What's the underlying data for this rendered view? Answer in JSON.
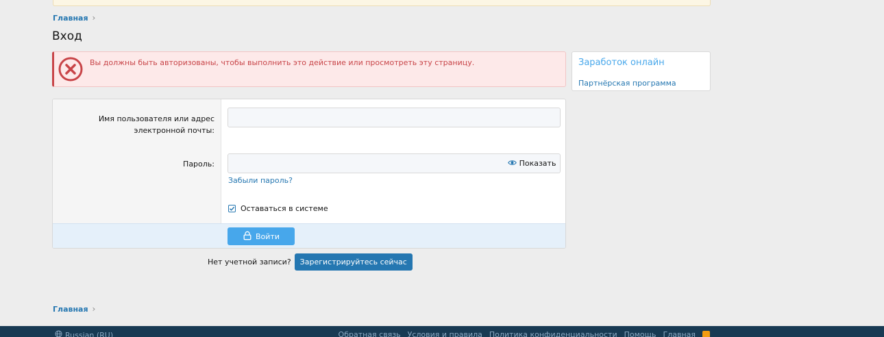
{
  "breadcrumb": {
    "home": "Главная",
    "separator": "›"
  },
  "page": {
    "title": "Вход"
  },
  "error": {
    "message": "Вы должны быть авторизованы, чтобы выполнить это действие или просмотреть эту страницу.",
    "icon": "error-circle-x-icon"
  },
  "sidebar": {
    "title": "Заработок онлайн",
    "link": "Партнёрская программа"
  },
  "form": {
    "username_label": "Имя пользователя или адрес электронной почты:",
    "username_value": "",
    "password_label": "Пароль:",
    "password_value": "",
    "show_label": "Показать",
    "forgot_label": "Забыли пароль?",
    "remember_label": "Оставаться в системе",
    "remember_checked": true,
    "submit_label": "Войти"
  },
  "register": {
    "prompt": "Нет учетной записи?",
    "button": "Зарегистрируйтесь сейчас"
  },
  "footer": {
    "language": "Russian (RU)",
    "links": [
      "Обратная связь",
      "Условия и правила",
      "Политика конфиденциальности",
      "Помощь",
      "Главная"
    ]
  },
  "colors": {
    "accent": "#47a7eb",
    "link": "#2577b1",
    "error": "#c84448",
    "footer_bg": "#183a53"
  }
}
